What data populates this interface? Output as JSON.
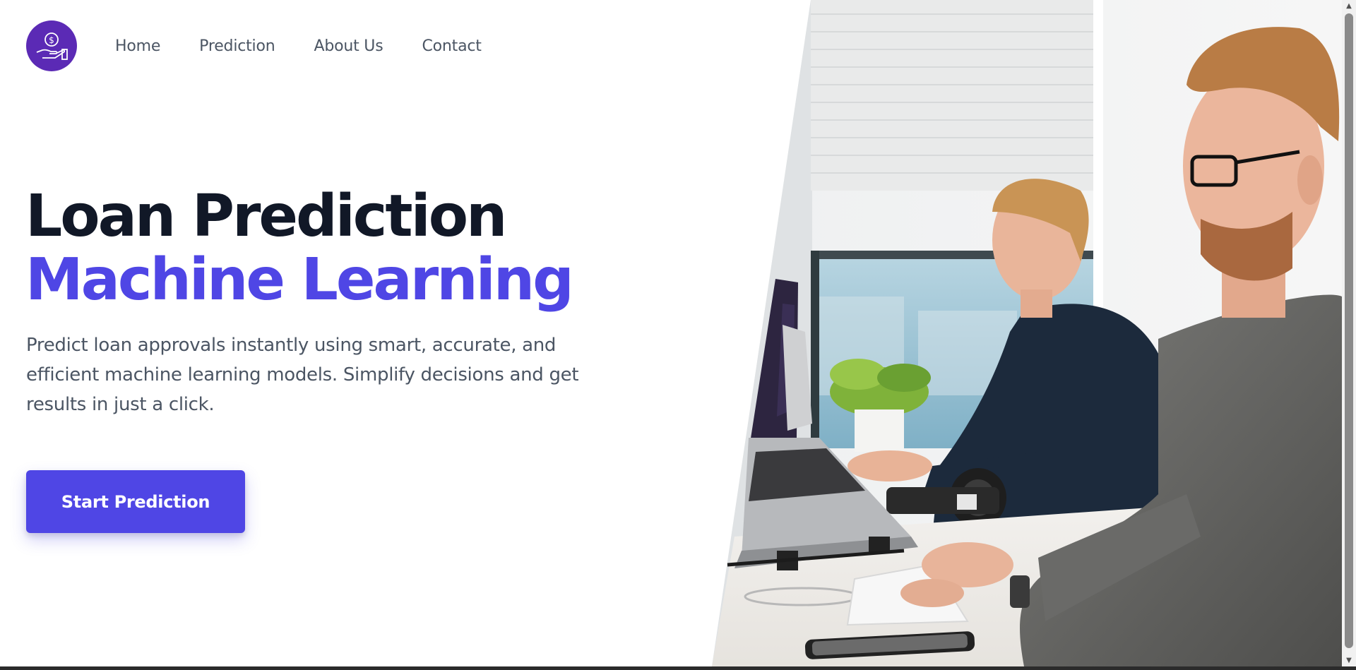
{
  "nav": {
    "logo_icon": "hand-holding-dollar-icon",
    "links": [
      "Home",
      "Prediction",
      "About Us",
      "Contact"
    ]
  },
  "hero": {
    "title_line1": "Loan Prediction",
    "title_line2": "Machine Learning",
    "description": "Predict loan approvals instantly using smart, accurate, and efficient machine learning models. Simplify decisions and get results in just a click.",
    "cta_label": "Start Prediction"
  },
  "colors": {
    "accent": "#4f46e5",
    "logo_bg": "#5b2ab5",
    "heading": "#111827",
    "body_text": "#4b5563"
  }
}
